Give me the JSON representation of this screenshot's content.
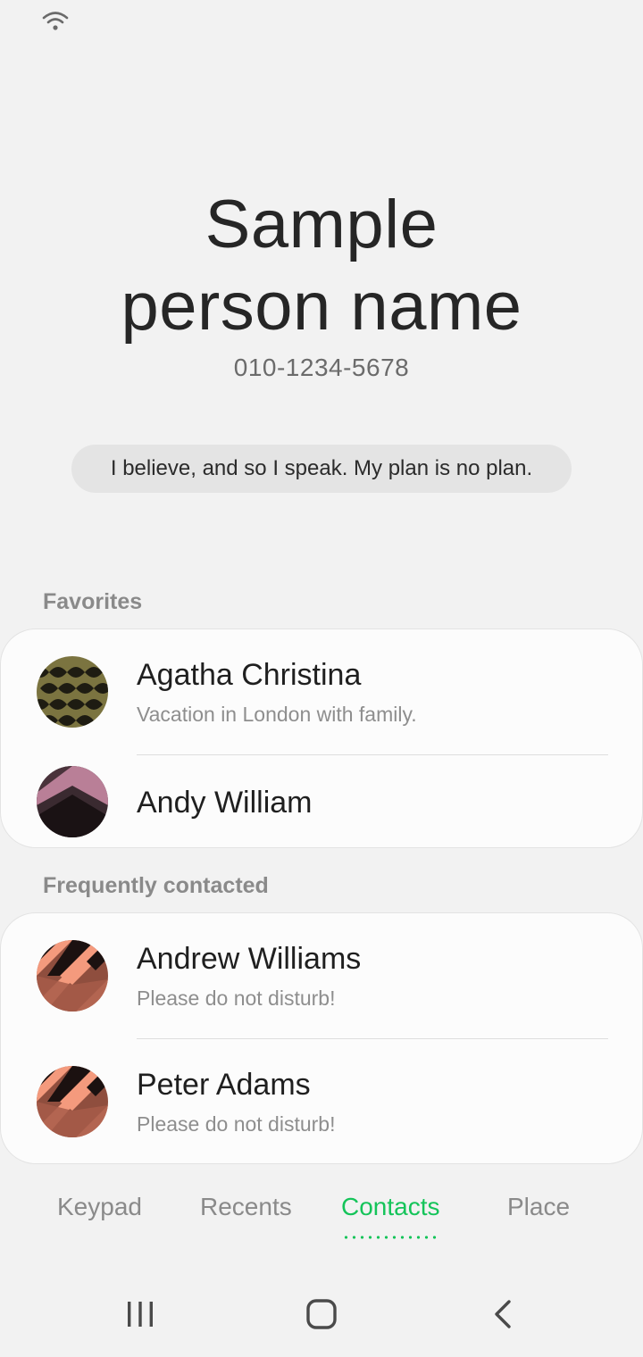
{
  "status_bar": {
    "wifi_icon": "wifi-icon"
  },
  "profile": {
    "name_line1": "Sample",
    "name_line2": "person name",
    "phone": "010-1234-5678",
    "status_message": "I believe, and so I speak. My plan is no plan."
  },
  "favorites": {
    "header": "Favorites",
    "items": [
      {
        "name": "Agatha Christina",
        "subtitle": "Vacation in London with family."
      },
      {
        "name": "Andy William",
        "subtitle": ""
      }
    ]
  },
  "frequent": {
    "header": "Frequently contacted",
    "items": [
      {
        "name": "Andrew Williams",
        "subtitle": "Please do not disturb!"
      },
      {
        "name": "Peter Adams",
        "subtitle": "Please do not disturb!"
      }
    ]
  },
  "tabs": [
    {
      "label": "Keypad",
      "active": false
    },
    {
      "label": "Recents",
      "active": false
    },
    {
      "label": "Contacts",
      "active": true
    },
    {
      "label": "Place",
      "active": false
    }
  ],
  "nav": {
    "recents_icon": "recent-apps-icon",
    "home_icon": "home-icon",
    "back_icon": "back-icon"
  },
  "colors": {
    "accent": "#15c45a",
    "background": "#f2f2f2",
    "card": "#fcfcfc"
  }
}
